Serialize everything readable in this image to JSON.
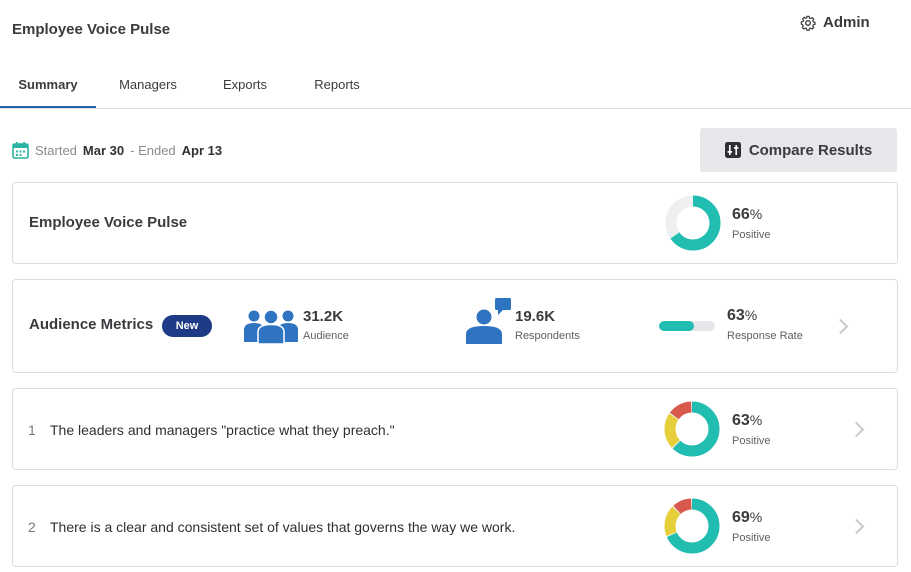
{
  "app": {
    "title": "Employee Voice Pulse"
  },
  "header": {
    "admin_label": "Admin",
    "admin_icon": "gear-icon"
  },
  "tabs": [
    {
      "label": "Summary",
      "active": true
    },
    {
      "label": "Managers",
      "active": false
    },
    {
      "label": "Exports",
      "active": false
    },
    {
      "label": "Reports",
      "active": false
    }
  ],
  "date_range": {
    "started_label": "Started",
    "start_date": "Mar 30",
    "separator": "- Ended",
    "end_date": "Apr 13",
    "icon": "calendar-icon"
  },
  "compare_button": {
    "label": "Compare Results",
    "icon": "sliders-icon"
  },
  "summary_card": {
    "title": "Employee Voice Pulse",
    "percent": "66",
    "percent_sign": "%",
    "caption": "Positive",
    "positive_fraction": 0.66
  },
  "audience_card": {
    "title": "Audience Metrics",
    "badge": "New",
    "audience": {
      "value": "31.2K",
      "label": "Audience",
      "icon": "people-group-icon"
    },
    "respondents": {
      "value": "19.6K",
      "label": "Respondents",
      "icon": "person-speech-icon"
    },
    "response_rate": {
      "value": "63",
      "sign": "%",
      "label": "Response Rate",
      "fraction": 0.63
    }
  },
  "questions": [
    {
      "number": "1",
      "text": "The leaders and managers \"practice what they preach.\"",
      "percent": "63",
      "percent_sign": "%",
      "caption": "Positive",
      "breakdown": {
        "positive": 0.63,
        "neutral": 0.22,
        "negative": 0.15
      }
    },
    {
      "number": "2",
      "text": "There is a clear and consistent set of values that governs the way we work.",
      "percent": "69",
      "percent_sign": "%",
      "caption": "Positive",
      "breakdown": {
        "positive": 0.69,
        "neutral": 0.19,
        "negative": 0.12
      }
    }
  ],
  "colors": {
    "positive": "#22bdb1",
    "neutral": "#e6cf3a",
    "negative": "#d9594c",
    "track": "#eeeff1",
    "accent_blue": "#2563a8",
    "icon_blue": "#2f74c0",
    "badge_navy": "#1d3c85",
    "calendar_teal": "#2bb3a3"
  }
}
